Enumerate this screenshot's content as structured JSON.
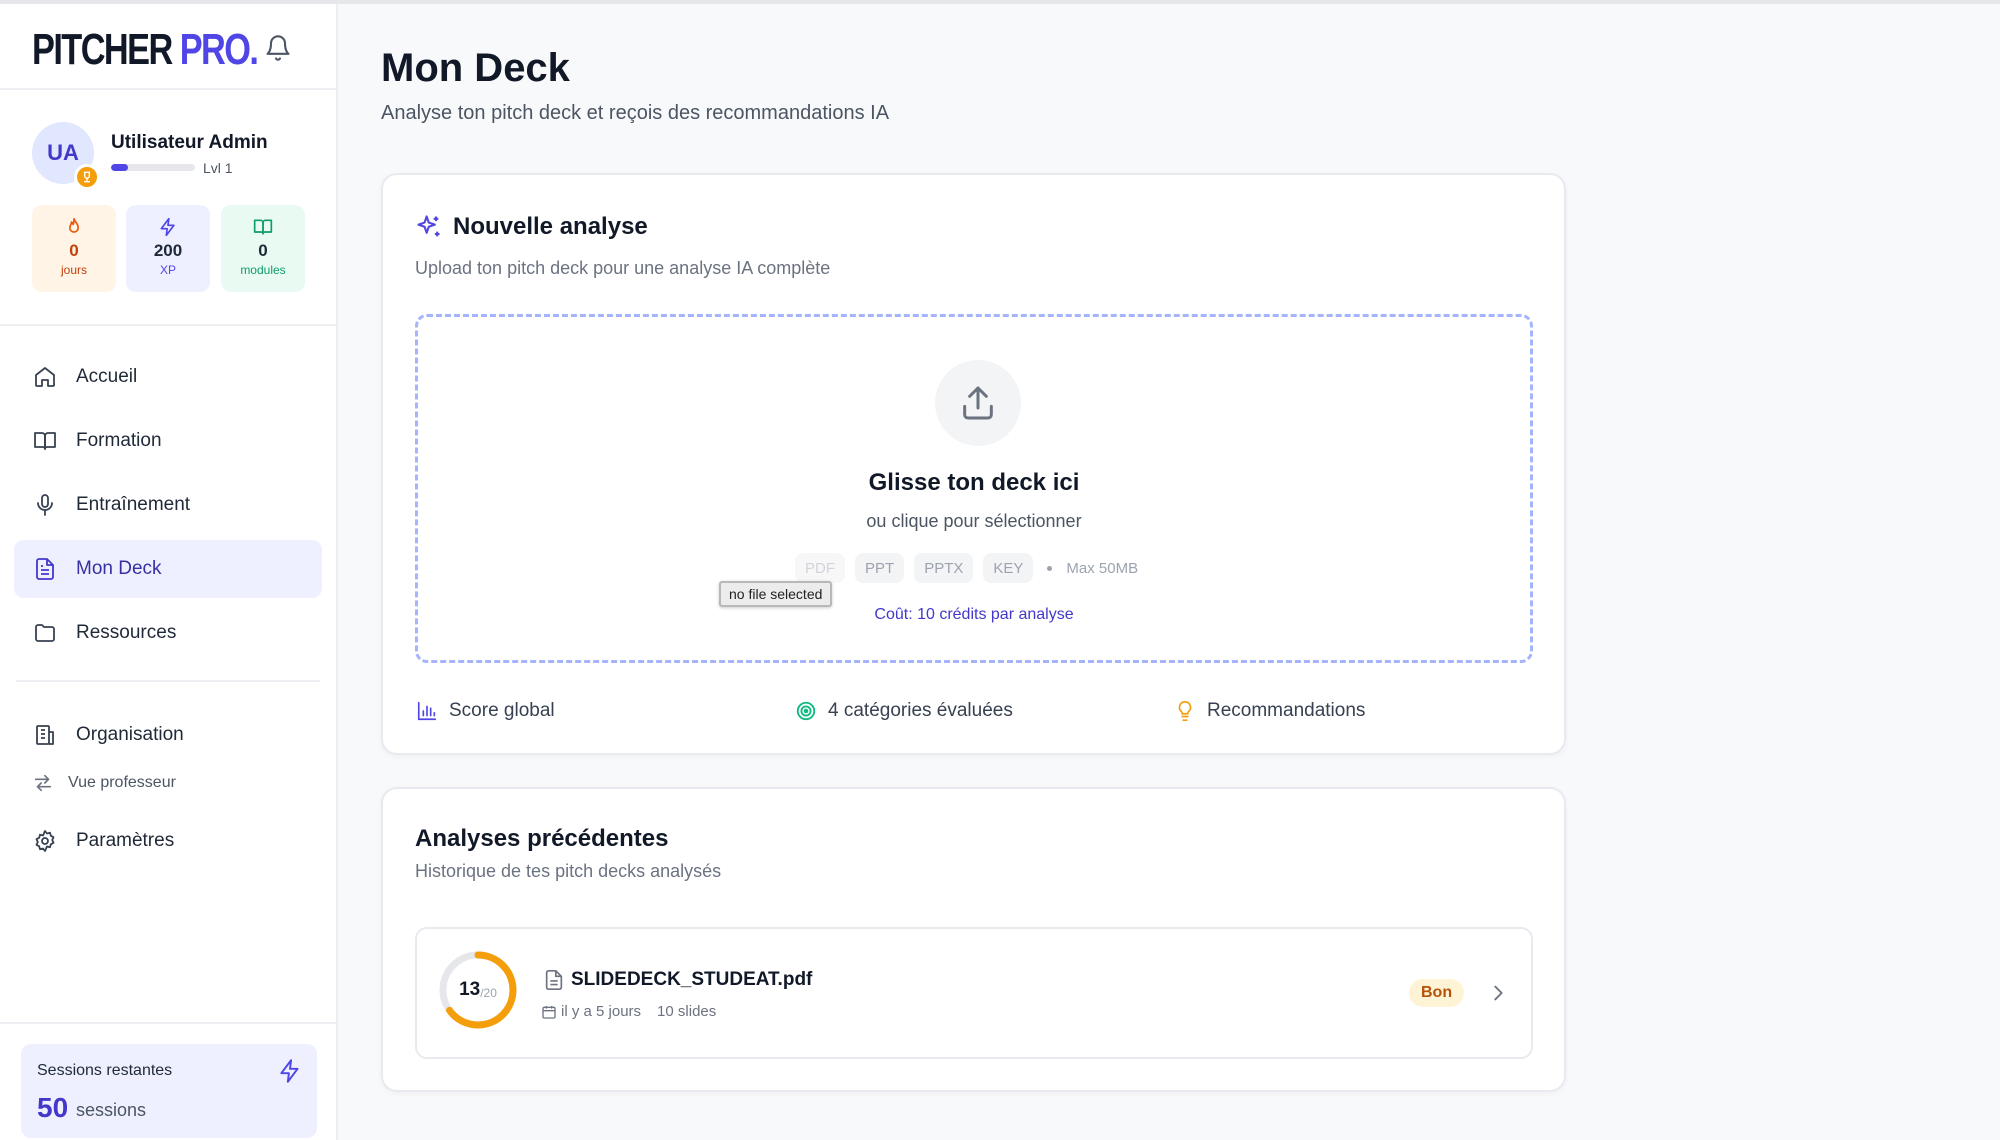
{
  "brand": {
    "part1": "PITCHER ",
    "part2": "PRO."
  },
  "user": {
    "initials": "UA",
    "name": "Utilisateur Admin",
    "level": "Lvl 1",
    "level_progress": 0.2
  },
  "stats": [
    {
      "value": "0",
      "unit": "jours",
      "icon": "flame-icon"
    },
    {
      "value": "200",
      "unit": "XP",
      "icon": "bolt-icon"
    },
    {
      "value": "0",
      "unit": "modules",
      "icon": "book-icon"
    }
  ],
  "nav": {
    "items": [
      {
        "label": "Accueil",
        "icon": "home-icon"
      },
      {
        "label": "Formation",
        "icon": "book-open-icon"
      },
      {
        "label": "Entraînement",
        "icon": "mic-icon"
      },
      {
        "label": "Mon Deck",
        "icon": "file-text-icon",
        "active": true
      },
      {
        "label": "Ressources",
        "icon": "folder-icon"
      }
    ],
    "secondary": [
      {
        "label": "Organisation",
        "icon": "building-icon"
      },
      {
        "label": "Vue professeur",
        "icon": "swap-icon"
      },
      {
        "label": "Paramètres",
        "icon": "gear-icon"
      }
    ]
  },
  "sessions": {
    "title": "Sessions restantes",
    "count": "50",
    "unit": "sessions"
  },
  "page": {
    "title": "Mon Deck",
    "subtitle": "Analyse ton pitch deck et reçois des recommandations IA"
  },
  "new_analysis": {
    "title": "Nouvelle analyse",
    "subtitle": "Upload ton pitch deck pour une analyse IA complète",
    "drop_title": "Glisse ton deck ici",
    "drop_subtitle": "ou clique pour sélectionner",
    "formats": [
      "PDF",
      "PPT",
      "PPTX",
      "KEY"
    ],
    "max_size": "Max 50MB",
    "file_input_tooltip": "no file selected",
    "cost": "Coût: 10 crédits par analyse",
    "features": [
      {
        "label": "Score global",
        "icon": "bar-chart-icon"
      },
      {
        "label": "4 catégories évaluées",
        "icon": "target-icon"
      },
      {
        "label": "Recommandations",
        "icon": "lightbulb-icon"
      }
    ]
  },
  "history": {
    "title": "Analyses précédentes",
    "subtitle": "Historique de tes pitch decks analysés",
    "items": [
      {
        "score": "13",
        "score_max": "/20",
        "score_fraction": 0.65,
        "file": "SLIDEDECK_STUDEAT.pdf",
        "date": "il y a 5 jours",
        "slides": "10 slides",
        "badge": "Bon"
      }
    ]
  },
  "colors": {
    "accent": "#4f46e5",
    "ring": "#f59e0b",
    "badge_bg": "#fff3d6",
    "badge_text": "#b45309"
  }
}
